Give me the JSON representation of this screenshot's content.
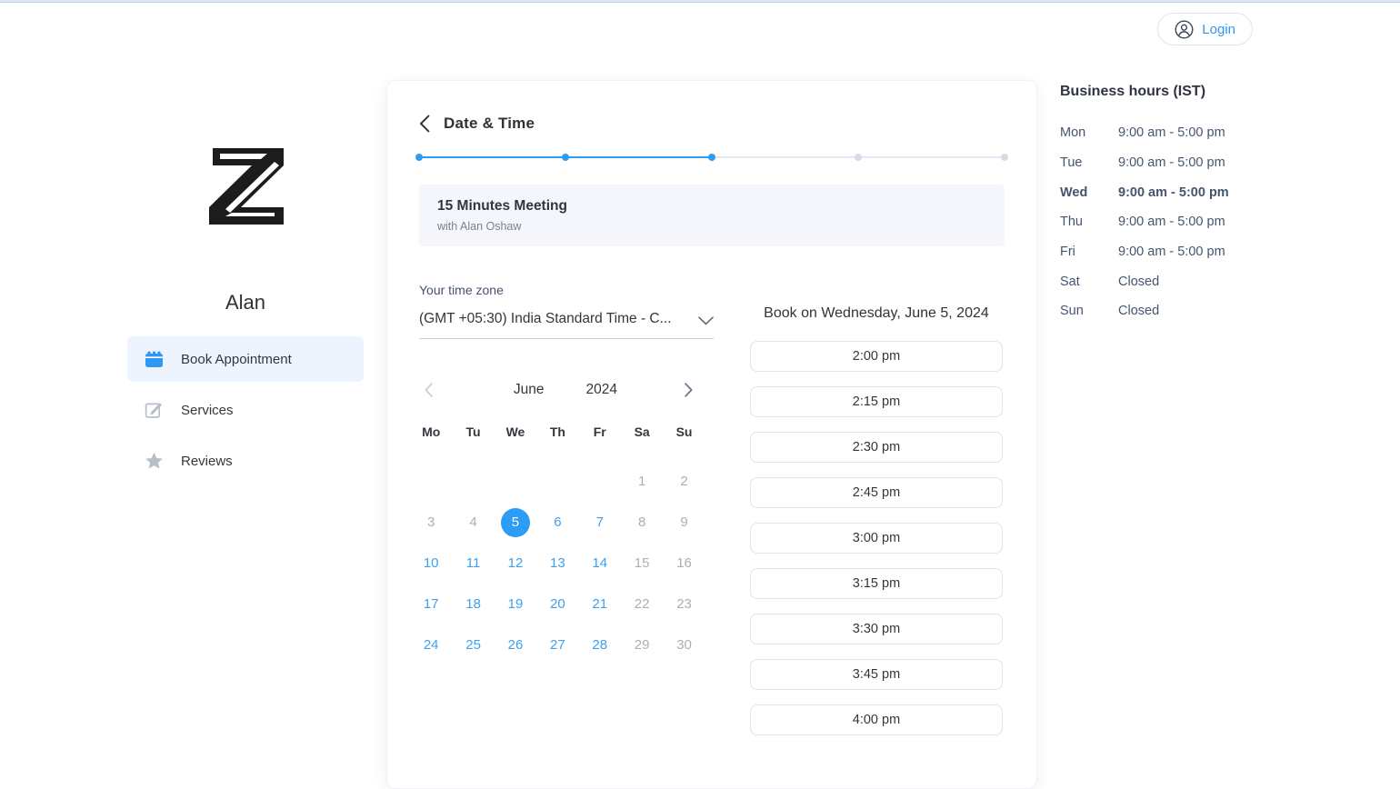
{
  "topbar": {
    "login_label": "Login"
  },
  "sidebar": {
    "business_name": "Alan",
    "items": [
      {
        "label": "Book Appointment",
        "icon": "calendar-icon",
        "active": true
      },
      {
        "label": "Services",
        "icon": "compose-icon",
        "active": false
      },
      {
        "label": "Reviews",
        "icon": "star-icon",
        "active": false
      }
    ]
  },
  "booking": {
    "step_title": "Date & Time",
    "progress": {
      "steps_total": 5,
      "steps_completed": 3
    },
    "service": {
      "name": "15 Minutes Meeting",
      "provider": "with Alan Oshaw"
    },
    "timezone": {
      "label": "Your time zone",
      "value": "(GMT +05:30) India Standard Time - C..."
    },
    "calendar": {
      "month": "June",
      "year": "2024",
      "prev_enabled": false,
      "next_enabled": true,
      "day_headers": [
        "Mo",
        "Tu",
        "We",
        "Th",
        "Fr",
        "Sa",
        "Su"
      ],
      "weeks": [
        [
          {
            "d": "",
            "s": "empty"
          },
          {
            "d": "",
            "s": "empty"
          },
          {
            "d": "",
            "s": "empty"
          },
          {
            "d": "",
            "s": "empty"
          },
          {
            "d": "",
            "s": "empty"
          },
          {
            "d": "1",
            "s": "disabled"
          },
          {
            "d": "2",
            "s": "disabled"
          }
        ],
        [
          {
            "d": "3",
            "s": "disabled"
          },
          {
            "d": "4",
            "s": "disabled"
          },
          {
            "d": "5",
            "s": "selected"
          },
          {
            "d": "6",
            "s": "available"
          },
          {
            "d": "7",
            "s": "available"
          },
          {
            "d": "8",
            "s": "disabled"
          },
          {
            "d": "9",
            "s": "disabled"
          }
        ],
        [
          {
            "d": "10",
            "s": "available"
          },
          {
            "d": "11",
            "s": "available"
          },
          {
            "d": "12",
            "s": "available"
          },
          {
            "d": "13",
            "s": "available"
          },
          {
            "d": "14",
            "s": "available"
          },
          {
            "d": "15",
            "s": "disabled"
          },
          {
            "d": "16",
            "s": "disabled"
          }
        ],
        [
          {
            "d": "17",
            "s": "available"
          },
          {
            "d": "18",
            "s": "available"
          },
          {
            "d": "19",
            "s": "available"
          },
          {
            "d": "20",
            "s": "available"
          },
          {
            "d": "21",
            "s": "available"
          },
          {
            "d": "22",
            "s": "disabled"
          },
          {
            "d": "23",
            "s": "disabled"
          }
        ],
        [
          {
            "d": "24",
            "s": "available"
          },
          {
            "d": "25",
            "s": "available"
          },
          {
            "d": "26",
            "s": "available"
          },
          {
            "d": "27",
            "s": "available"
          },
          {
            "d": "28",
            "s": "available"
          },
          {
            "d": "29",
            "s": "disabled"
          },
          {
            "d": "30",
            "s": "disabled"
          }
        ]
      ]
    },
    "slots": {
      "heading": "Book on Wednesday, June 5, 2024",
      "times": [
        "2:00 pm",
        "2:15 pm",
        "2:30 pm",
        "2:45 pm",
        "3:00 pm",
        "3:15 pm",
        "3:30 pm",
        "3:45 pm",
        "4:00 pm"
      ]
    }
  },
  "business_hours": {
    "title": "Business hours (IST)",
    "rows": [
      {
        "day": "Mon",
        "hours": "9:00 am - 5:00 pm",
        "current": false
      },
      {
        "day": "Tue",
        "hours": "9:00 am - 5:00 pm",
        "current": false
      },
      {
        "day": "Wed",
        "hours": "9:00 am - 5:00 pm",
        "current": true
      },
      {
        "day": "Thu",
        "hours": "9:00 am - 5:00 pm",
        "current": false
      },
      {
        "day": "Fri",
        "hours": "9:00 am - 5:00 pm",
        "current": false
      },
      {
        "day": "Sat",
        "hours": "Closed",
        "current": false
      },
      {
        "day": "Sun",
        "hours": "Closed",
        "current": false
      }
    ]
  },
  "colors": {
    "accent_blue": "#2d9cf4",
    "link_blue": "#2f98f4",
    "available_date": "#3da0f2",
    "disabled_text": "#a9aeb9",
    "muted_text": "#45546e",
    "banner_bg": "#f4f6fb",
    "active_menu_bg": "#edf4fd",
    "top_strip": "#dce4f5"
  }
}
